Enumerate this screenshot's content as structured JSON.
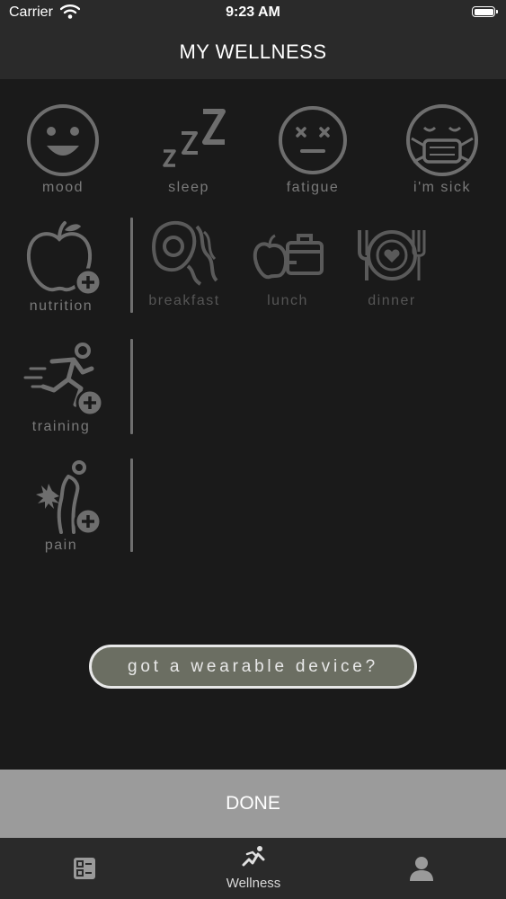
{
  "status_bar": {
    "carrier": "Carrier",
    "time": "9:23 AM"
  },
  "header": {
    "title": "MY WELLNESS"
  },
  "feelings": [
    {
      "label": "mood",
      "icon": "smiley-face-icon"
    },
    {
      "label": "sleep",
      "icon": "zzz-sleep-icon"
    },
    {
      "label": "fatigue",
      "icon": "tired-face-icon"
    },
    {
      "label": "i'm sick",
      "icon": "mask-face-icon"
    }
  ],
  "categories": {
    "nutrition": {
      "label": "nutrition",
      "icon": "apple-plus-icon"
    },
    "training": {
      "label": "training",
      "icon": "runner-plus-icon"
    },
    "pain": {
      "label": "pain",
      "icon": "body-pain-plus-icon"
    }
  },
  "meals": [
    {
      "label": "breakfast",
      "icon": "egg-bacon-icon"
    },
    {
      "label": "lunch",
      "icon": "lunchbox-icon"
    },
    {
      "label": "dinner",
      "icon": "plate-cutlery-icon"
    }
  ],
  "wearable_button": {
    "label": "got a wearable device?"
  },
  "done_button": {
    "label": "DONE"
  },
  "tab_bar": {
    "tabs": [
      {
        "label": "",
        "icon": "checklist-icon"
      },
      {
        "label": "Wellness",
        "icon": "wellness-activity-icon",
        "selected": true
      },
      {
        "label": "",
        "icon": "profile-icon"
      }
    ]
  }
}
